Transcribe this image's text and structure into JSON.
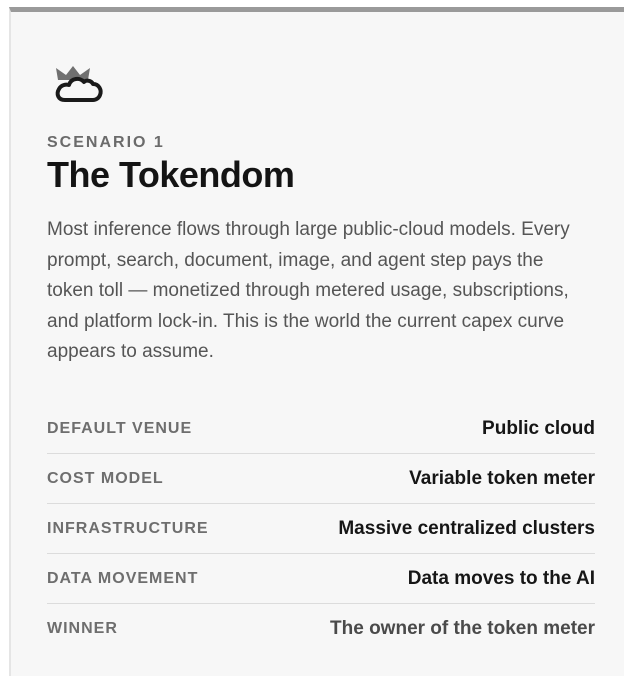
{
  "card": {
    "icon": "cloud-crown-icon",
    "eyebrow": "SCENARIO 1",
    "title": "The Tokendom",
    "description": "Most inference flows through large public-cloud models. Every prompt, search, document, image, and agent step pays the token toll — monetized through metered usage, subscriptions, and platform lock-in. This is the world the current capex curve appears to assume.",
    "rows": [
      {
        "label": "DEFAULT VENUE",
        "value": "Public cloud"
      },
      {
        "label": "COST MODEL",
        "value": "Variable token meter"
      },
      {
        "label": "INFRASTRUCTURE",
        "value": "Massive centralized clusters"
      },
      {
        "label": "DATA MOVEMENT",
        "value": "Data moves to the AI"
      },
      {
        "label": "WINNER",
        "value": "The owner of the token meter"
      }
    ]
  },
  "colors": {
    "top_border": "#9a9a9a",
    "card_background": "#f7f7f7",
    "icon_fill": "#707070",
    "icon_stroke": "#1a1a1a"
  }
}
